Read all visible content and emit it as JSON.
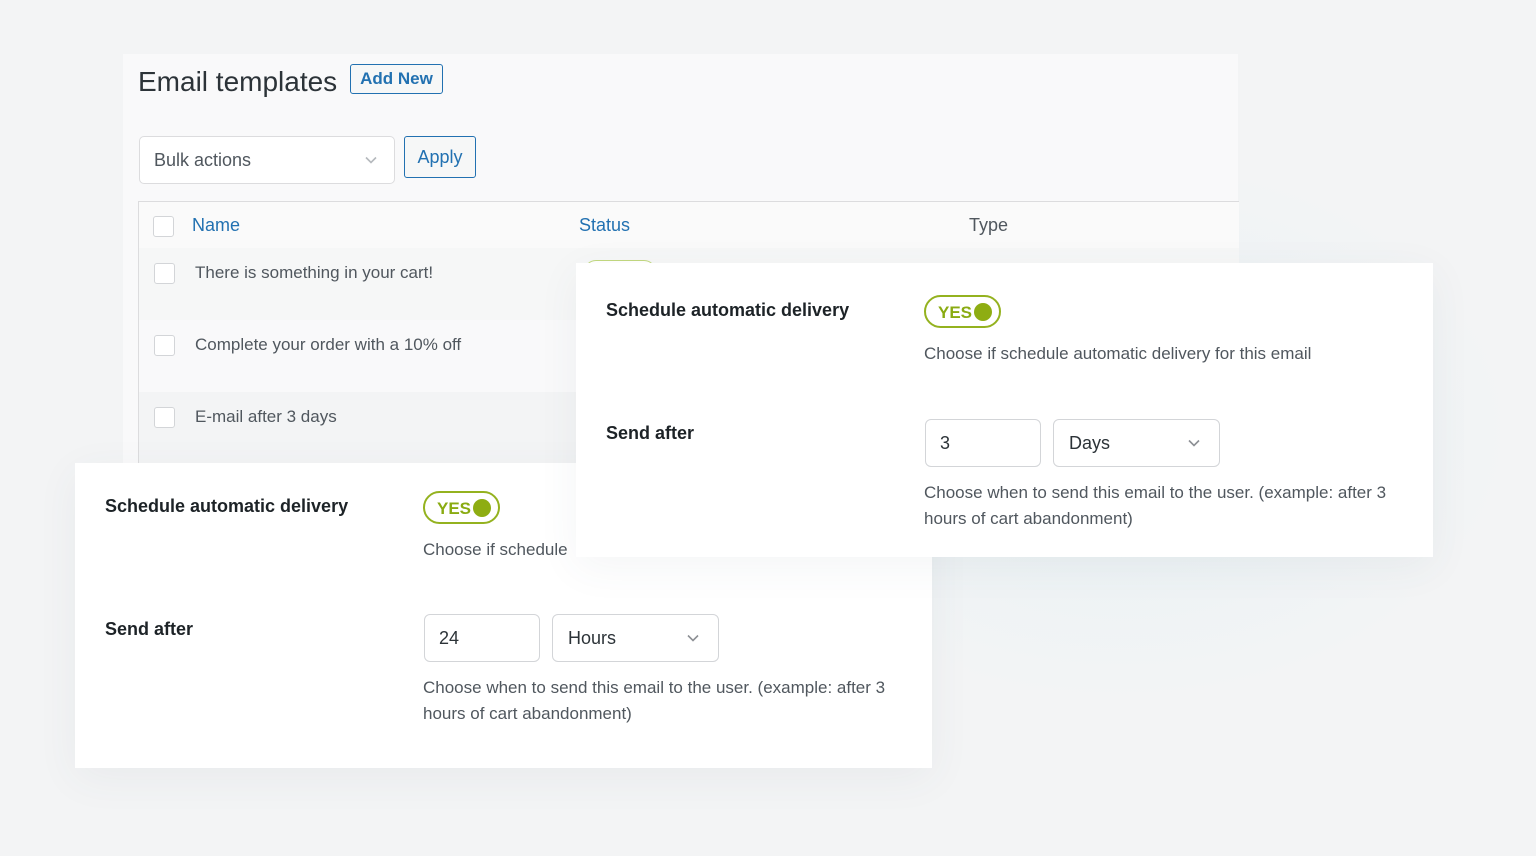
{
  "list_page": {
    "title": "Email templates",
    "add_new_label": "Add New",
    "bulk_actions": {
      "selected": "Bulk actions"
    },
    "apply_label": "Apply",
    "columns": [
      "Name",
      "Status",
      "Type"
    ],
    "rows": [
      {
        "name": "There is something in your cart!"
      },
      {
        "name": "Complete your order with a 10% off"
      },
      {
        "name": "E-mail after 3 days"
      }
    ]
  },
  "delivery_cards": [
    {
      "schedule_label": "Schedule automatic delivery",
      "toggle_label": "YES",
      "toggle_on": true,
      "schedule_desc": "Choose if schedule",
      "send_after_label": "Send after",
      "send_after_value": "24",
      "send_after_unit": "Hours",
      "send_after_desc": "Choose when to send this email to the user. (example: after 3 hours of cart abandonment)"
    },
    {
      "schedule_label": "Schedule automatic delivery",
      "toggle_label": "YES",
      "toggle_on": true,
      "schedule_desc": "Choose if schedule automatic delivery for this email",
      "send_after_label": "Send after",
      "send_after_value": "3",
      "send_after_unit": "Days",
      "send_after_desc": "Choose when to send this email to the user. (example: after 3 hours of cart abandonment)"
    }
  ],
  "colors": {
    "link_blue": "#2271b1",
    "toggle_green": "#8ead12",
    "text": "#50575e",
    "heading": "#1d2327"
  }
}
